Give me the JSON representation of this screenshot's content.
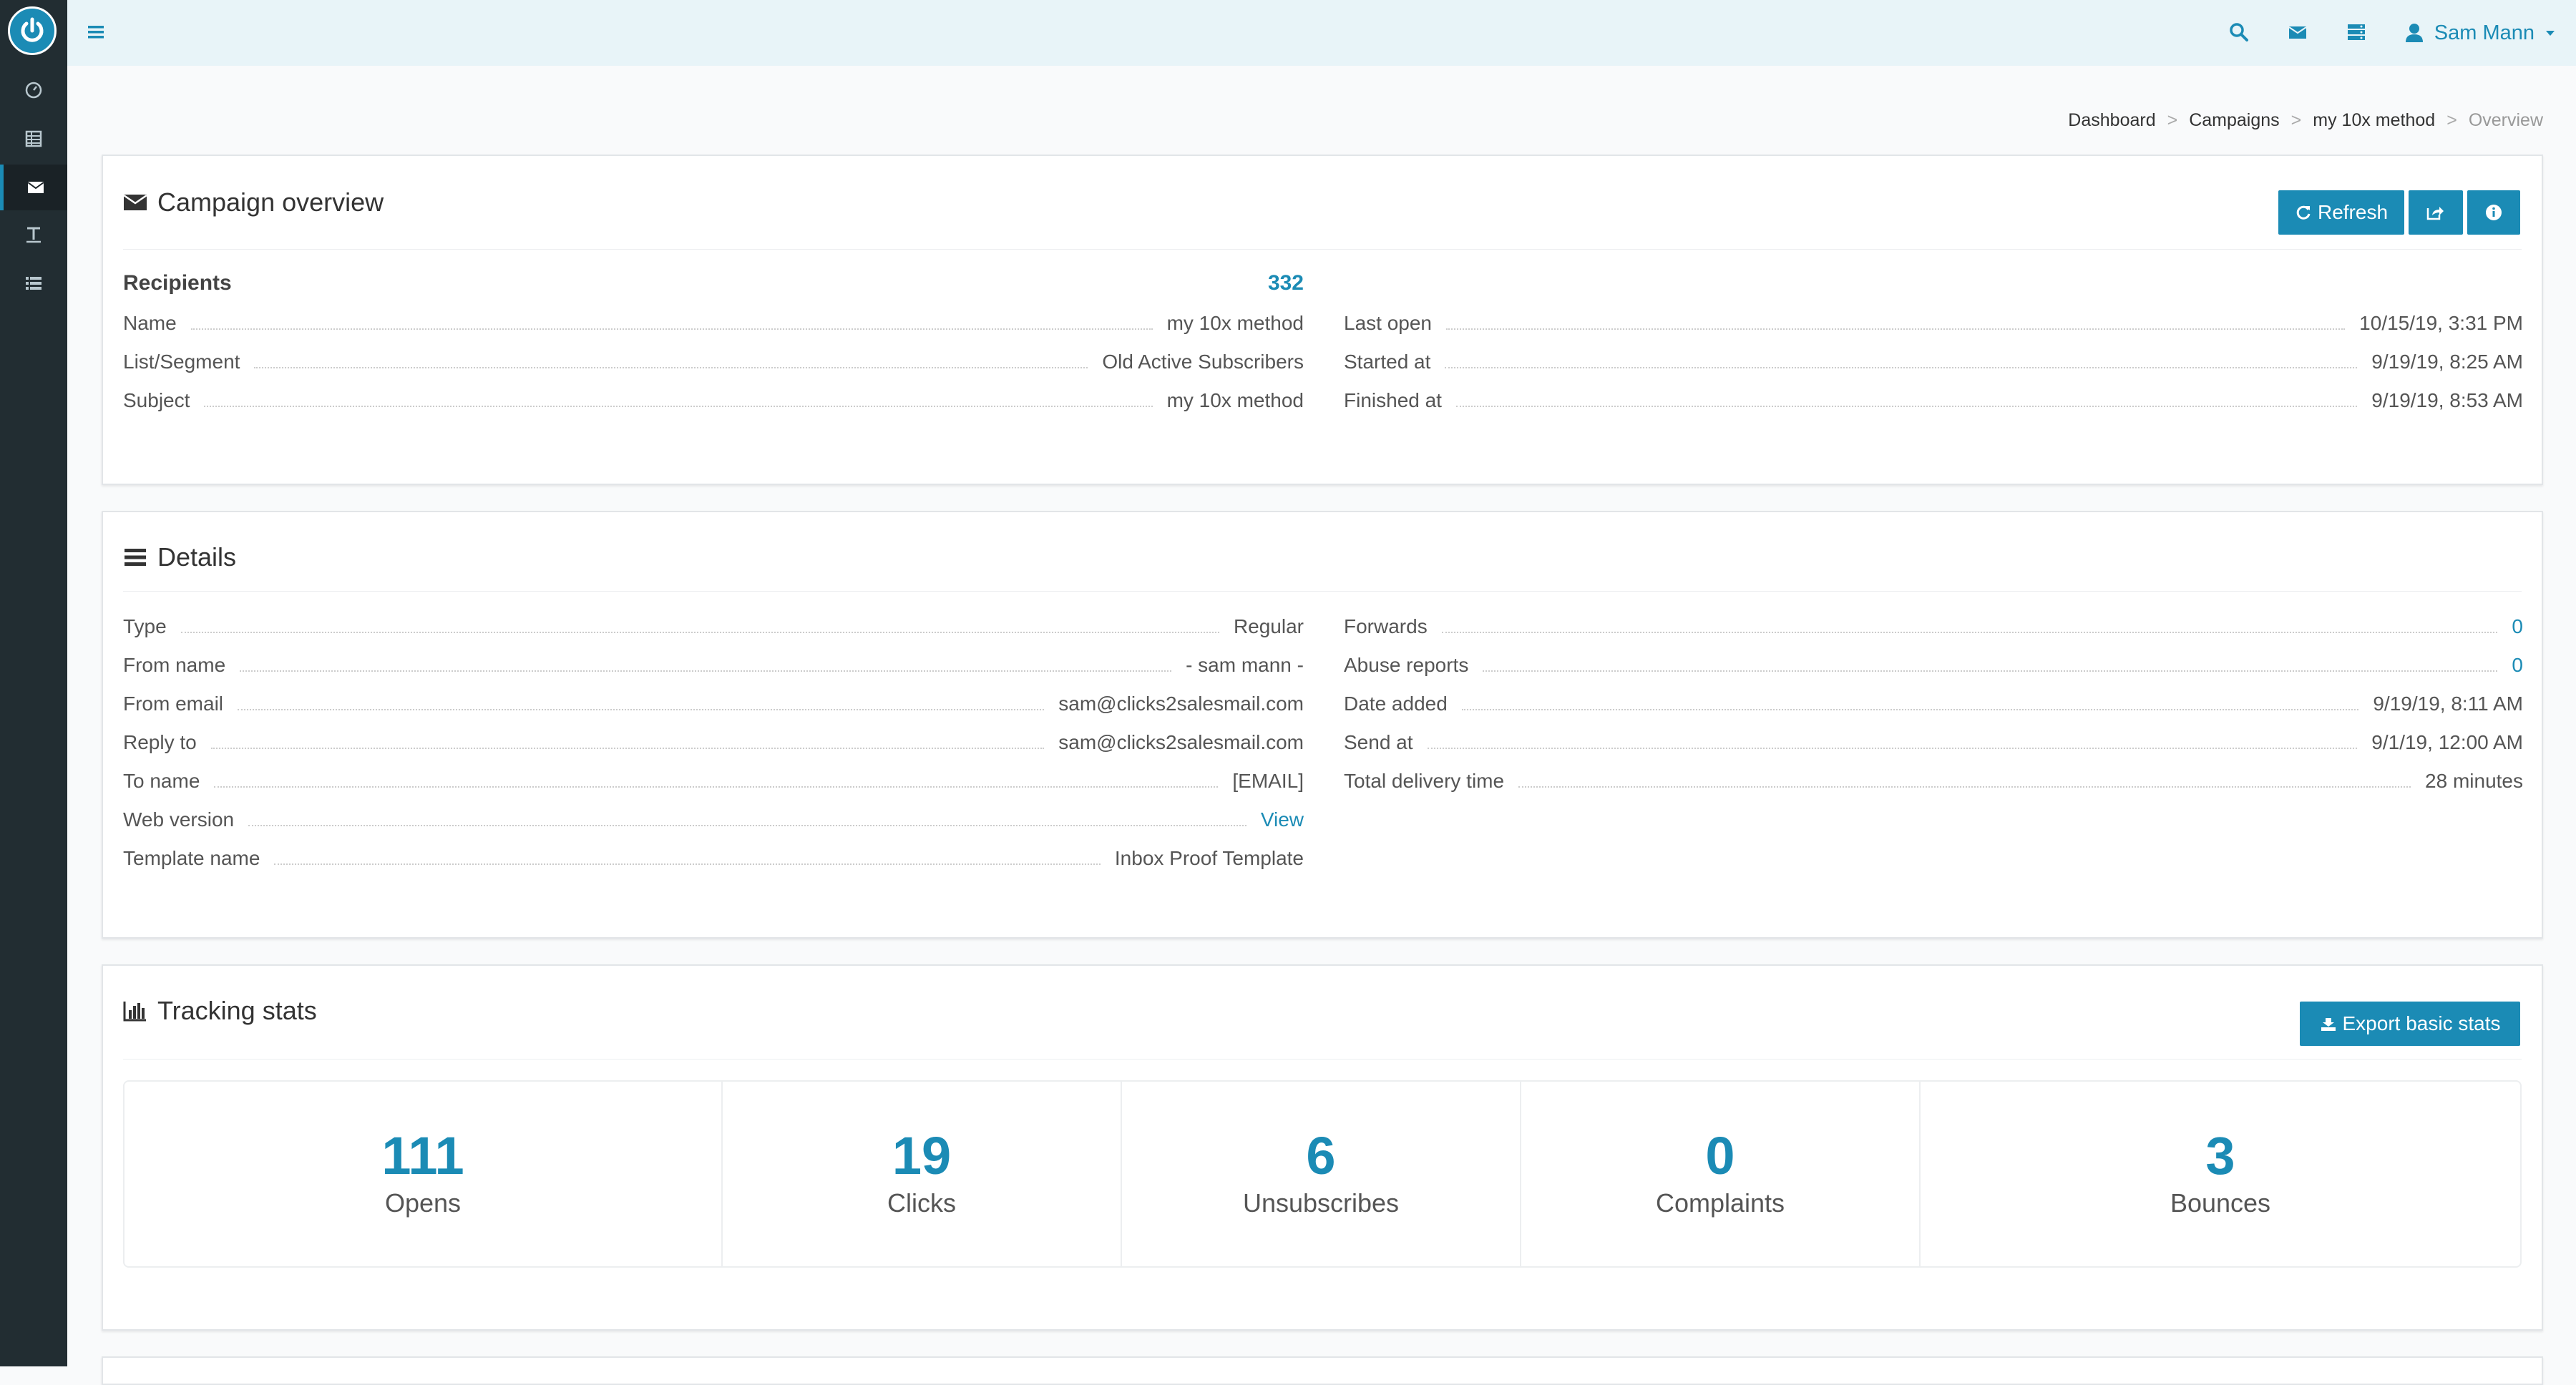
{
  "user": {
    "name": "Sam Mann"
  },
  "breadcrumb": [
    "Dashboard",
    "Campaigns",
    "my 10x method",
    "Overview"
  ],
  "overview": {
    "title": "Campaign overview",
    "refresh_label": "Refresh",
    "recipients_label": "Recipients",
    "recipients_value": "332",
    "left_rows": [
      {
        "k": "Name",
        "v": "my 10x method"
      },
      {
        "k": "List/Segment",
        "v": "Old Active Subscribers"
      },
      {
        "k": "Subject",
        "v": "my 10x method"
      }
    ],
    "right_rows": [
      {
        "k": "Last open",
        "v": "10/15/19, 3:31 PM"
      },
      {
        "k": "Started at",
        "v": "9/19/19, 8:25 AM"
      },
      {
        "k": "Finished at",
        "v": "9/19/19, 8:53 AM"
      }
    ]
  },
  "details": {
    "title": "Details",
    "left_rows": [
      {
        "k": "Type",
        "v": "Regular"
      },
      {
        "k": "From name",
        "v": "- sam mann -"
      },
      {
        "k": "From email",
        "v": "sam@clicks2salesmail.com"
      },
      {
        "k": "Reply to",
        "v": "sam@clicks2salesmail.com"
      },
      {
        "k": "To name",
        "v": "[EMAIL]"
      },
      {
        "k": "Web version",
        "v": "View"
      },
      {
        "k": "Template name",
        "v": "Inbox Proof Template"
      }
    ],
    "right_rows": [
      {
        "k": "Forwards",
        "v": "0"
      },
      {
        "k": "Abuse reports",
        "v": "0"
      },
      {
        "k": "Date added",
        "v": "9/19/19, 8:11 AM"
      },
      {
        "k": "Send at",
        "v": "9/1/19, 12:00 AM"
      },
      {
        "k": "Total delivery time",
        "v": "28 minutes"
      }
    ]
  },
  "tracking": {
    "title": "Tracking stats",
    "export_label": "Export basic stats",
    "stats": [
      {
        "num": "111",
        "label": "Opens"
      },
      {
        "num": "19",
        "label": "Clicks"
      },
      {
        "num": "6",
        "label": "Unsubscribes"
      },
      {
        "num": "0",
        "label": "Complaints"
      },
      {
        "num": "3",
        "label": "Bounces"
      }
    ]
  },
  "colors": {
    "accent": "#1b8bb5",
    "sidebar": "#222d32",
    "topbar": "#e8f4f8"
  }
}
